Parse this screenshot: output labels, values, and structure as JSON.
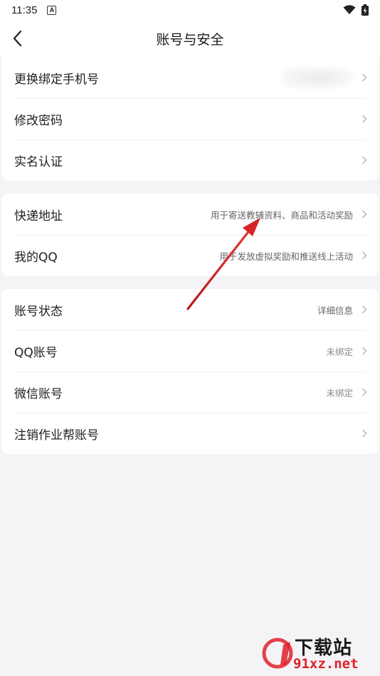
{
  "status": {
    "time": "11:35",
    "notification_icon": "a-icon"
  },
  "header": {
    "title": "账号与安全"
  },
  "groups": [
    {
      "items": [
        {
          "label": "更换绑定手机号",
          "value": ""
        },
        {
          "label": "修改密码",
          "value": ""
        },
        {
          "label": "实名认证",
          "value": ""
        }
      ]
    },
    {
      "items": [
        {
          "label": "快递地址",
          "value": "用于寄送教辅资料、商品和活动奖励"
        },
        {
          "label": "我的QQ",
          "value": "用于发放虚拟奖励和推送线上活动"
        }
      ]
    },
    {
      "items": [
        {
          "label": "账号状态",
          "value": "详细信息"
        },
        {
          "label": "QQ账号",
          "value": "未绑定"
        },
        {
          "label": "微信账号",
          "value": "未绑定"
        },
        {
          "label": "注销作业帮账号",
          "value": ""
        }
      ]
    }
  ],
  "watermark": {
    "brand": "下载站",
    "site": "91xz.net"
  },
  "colors": {
    "arrow": "#d42424",
    "watermark": "#e0202a",
    "background": "#f4f4f6"
  }
}
